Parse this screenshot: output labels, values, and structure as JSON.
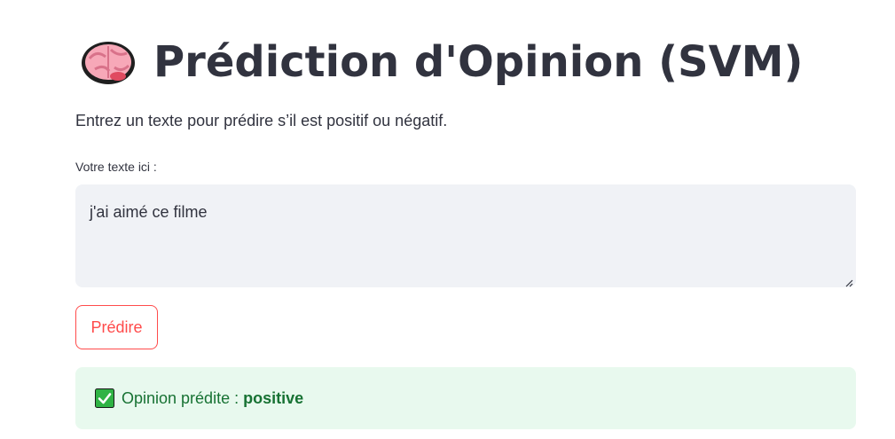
{
  "header": {
    "title": "Prédiction d'Opinion (SVM)",
    "title_icon": "brain-icon"
  },
  "intro": {
    "text": "Entrez un texte pour prédire s’il est positif ou négatif."
  },
  "input": {
    "label": "Votre texte ici :",
    "value": "j'ai aimé ce filme"
  },
  "actions": {
    "predict_label": "Prédire"
  },
  "result": {
    "icon": "check-mark-icon",
    "label": "Opinion prédite :",
    "value": "positive"
  },
  "colors": {
    "text": "#31333f",
    "accent": "#ff4b4b",
    "input_bg": "#f0f2f6",
    "success_bg": "#e8f9ee",
    "success_text": "#177233",
    "check_green": "#2fb344"
  }
}
